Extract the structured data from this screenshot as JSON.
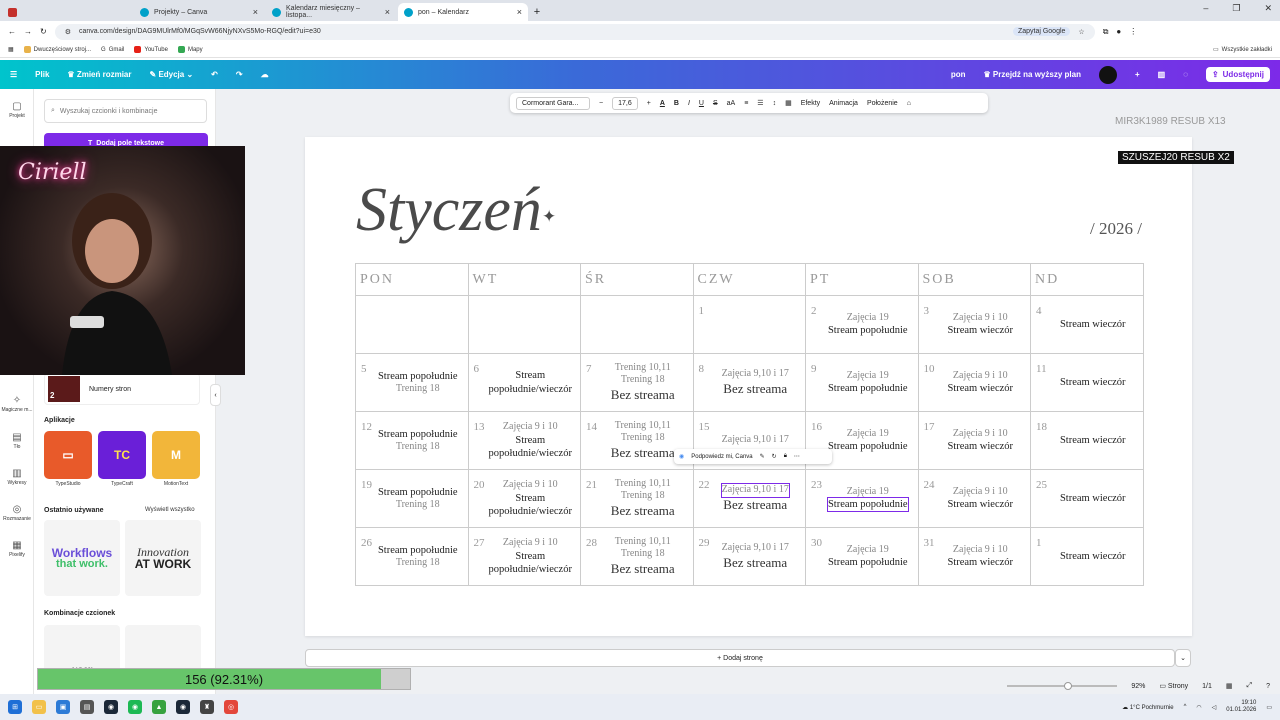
{
  "browser": {
    "tabs": [
      {
        "title": "Projekty – Canva",
        "icon": "canva"
      },
      {
        "title": "Kalendarz miesięczny – listopa...",
        "icon": "canva"
      },
      {
        "title": "pon – Kalendarz",
        "icon": "canva",
        "active": true
      }
    ],
    "url": "canva.com/design/DAG9MUlrMf0/MGqSvW66NjyNXvS5Mo-RGQ/edit?ui=e30",
    "google_button": "Zapytaj Google",
    "bookmarks": [
      "Dwuczęściowy stroj...",
      "Gmail",
      "YouTube",
      "Mapy"
    ],
    "all_bookmarks": "Wszystkie zakładki"
  },
  "canva_toolbar": {
    "file": "Plik",
    "resize": "Zmień rozmiar",
    "edit": "Edycja",
    "design_name": "pon",
    "upgrade": "Przejdź na wyższy plan",
    "share": "Udostępnij"
  },
  "rail": [
    "Projekt",
    "Magiczne m...",
    "Tło",
    "Wykresy",
    "Rozmazanie",
    "Pixelify"
  ],
  "panel": {
    "search_placeholder": "Wyszukaj czcionki i kombinacje",
    "add_text_button": "Dodaj pole tekstowe",
    "page_numbers": "Numery stron",
    "apps_title": "Aplikacje",
    "apps": [
      "TypeStudio",
      "TypeCraft",
      "MotionText"
    ],
    "recent_title": "Ostatnio używane",
    "show_all": "Wyświetl wszystko",
    "recent_items": [
      "Workflows",
      "that work.",
      "Innovation",
      "AT WORK"
    ],
    "combos_title": "Kombinacje czcionek",
    "combo_items": [
      "user"
    ]
  },
  "webcam_overlay": {
    "neon": "Ciriell"
  },
  "text_toolbar": {
    "font": "Cormorant Gara...",
    "size": "17,6",
    "effects": "Efekty",
    "animation": "Animacja",
    "position": "Położenie"
  },
  "stream_overlay": {
    "sub_faded": "MIR3K1989  RESUB X13",
    "sub_highlight": "SZUSZEJ20  RESUB X2"
  },
  "calendar": {
    "month": "Styczeń",
    "star": "✦",
    "year": "/ 2026 /",
    "weekdays": [
      "PON",
      "WT",
      "ŚR",
      "CZW",
      "PT",
      "SOB",
      "ND"
    ],
    "weeks": [
      [
        {
          "day": "",
          "lines": []
        },
        {
          "day": "",
          "lines": []
        },
        {
          "day": "",
          "lines": []
        },
        {
          "day": "1",
          "lines": []
        },
        {
          "day": "2",
          "lines": [
            {
              "t": "Zajęcia 19",
              "s": "g"
            },
            {
              "t": "Stream popołudnie",
              "s": "d"
            }
          ]
        },
        {
          "day": "3",
          "lines": [
            {
              "t": "Zajęcia 9 i 10",
              "s": "g"
            },
            {
              "t": "Stream wieczór",
              "s": "d"
            }
          ]
        },
        {
          "day": "4",
          "lines": [
            {
              "t": "Stream wieczór",
              "s": "d"
            }
          ]
        }
      ],
      [
        {
          "day": "5",
          "lines": [
            {
              "t": "Stream popołudnie",
              "s": "d"
            },
            {
              "t": "Trening 18",
              "s": "g"
            }
          ]
        },
        {
          "day": "6",
          "lines": [
            {
              "t": "Stream popołudnie/wieczór",
              "s": "d"
            }
          ]
        },
        {
          "day": "7",
          "lines": [
            {
              "t": "Trening 10,11",
              "s": "g"
            },
            {
              "t": "Trening 18",
              "s": "g"
            },
            {
              "t": "Bez streama",
              "s": "b"
            }
          ]
        },
        {
          "day": "8",
          "lines": [
            {
              "t": "Zajęcia 9,10 i 17",
              "s": "g"
            },
            {
              "t": "Bez streama",
              "s": "b"
            }
          ]
        },
        {
          "day": "9",
          "lines": [
            {
              "t": "Zajęcia 19",
              "s": "g"
            },
            {
              "t": "Stream popołudnie",
              "s": "d"
            }
          ]
        },
        {
          "day": "10",
          "lines": [
            {
              "t": "Zajęcia 9 i 10",
              "s": "g"
            },
            {
              "t": "Stream wieczór",
              "s": "d"
            }
          ]
        },
        {
          "day": "11",
          "lines": [
            {
              "t": "Stream wieczór",
              "s": "d"
            }
          ]
        }
      ],
      [
        {
          "day": "12",
          "lines": [
            {
              "t": "Stream popołudnie",
              "s": "d"
            },
            {
              "t": "Trening 18",
              "s": "g"
            }
          ]
        },
        {
          "day": "13",
          "lines": [
            {
              "t": "Zajęcia 9 i 10",
              "s": "g"
            },
            {
              "t": "Stream popołudnie/wieczór",
              "s": "d"
            }
          ]
        },
        {
          "day": "14",
          "lines": [
            {
              "t": "Trening 10,11",
              "s": "g"
            },
            {
              "t": "Trening 18",
              "s": "g"
            },
            {
              "t": "Bez streama",
              "s": "b"
            }
          ]
        },
        {
          "day": "15",
          "lines": [
            {
              "t": "Zajęcia 9,10 i 17",
              "s": "g"
            }
          ]
        },
        {
          "day": "16",
          "lines": [
            {
              "t": "Zajęcia 19",
              "s": "g"
            },
            {
              "t": "Stream popołudnie",
              "s": "d"
            }
          ]
        },
        {
          "day": "17",
          "lines": [
            {
              "t": "Zajęcia 9 i 10",
              "s": "g"
            },
            {
              "t": "Stream wieczór",
              "s": "d"
            }
          ]
        },
        {
          "day": "18",
          "lines": [
            {
              "t": "Stream wieczór",
              "s": "d"
            }
          ]
        }
      ],
      [
        {
          "day": "19",
          "lines": [
            {
              "t": "Stream popołudnie",
              "s": "d"
            },
            {
              "t": "Trening 18",
              "s": "g"
            }
          ]
        },
        {
          "day": "20",
          "lines": [
            {
              "t": "Zajęcia 9 i 10",
              "s": "g"
            },
            {
              "t": "Stream popołudnie/wieczór",
              "s": "d"
            }
          ]
        },
        {
          "day": "21",
          "lines": [
            {
              "t": "Trening 10,11",
              "s": "g"
            },
            {
              "t": "Trening 18",
              "s": "g"
            },
            {
              "t": "Bez streama",
              "s": "b"
            }
          ]
        },
        {
          "day": "22",
          "lines": [
            {
              "t": "Zajęcia 9,10 i 17",
              "s": "g",
              "sel": true
            },
            {
              "t": "Bez streama",
              "s": "b"
            }
          ]
        },
        {
          "day": "23",
          "lines": [
            {
              "t": "Zajęcia 19",
              "s": "g"
            },
            {
              "t": "Stream popołudnie",
              "s": "d",
              "sel": true
            }
          ]
        },
        {
          "day": "24",
          "lines": [
            {
              "t": "Zajęcia 9 i 10",
              "s": "g"
            },
            {
              "t": "Stream wieczór",
              "s": "d"
            }
          ]
        },
        {
          "day": "25",
          "lines": [
            {
              "t": "Stream wieczór",
              "s": "d"
            }
          ]
        }
      ],
      [
        {
          "day": "26",
          "lines": [
            {
              "t": "Stream popołudnie",
              "s": "d"
            },
            {
              "t": "Trening 18",
              "s": "g"
            }
          ]
        },
        {
          "day": "27",
          "lines": [
            {
              "t": "Zajęcia 9 i 10",
              "s": "g"
            },
            {
              "t": "Stream popołudnie/wieczór",
              "s": "d"
            }
          ]
        },
        {
          "day": "28",
          "lines": [
            {
              "t": "Trening 10,11",
              "s": "g"
            },
            {
              "t": "Trening 18",
              "s": "g"
            },
            {
              "t": "Bez streama",
              "s": "b"
            }
          ]
        },
        {
          "day": "29",
          "lines": [
            {
              "t": "Zajęcia 9,10 i 17",
              "s": "g"
            },
            {
              "t": "Bez streama",
              "s": "b"
            }
          ]
        },
        {
          "day": "30",
          "lines": [
            {
              "t": "Zajęcia 19",
              "s": "g"
            },
            {
              "t": "Stream popołudnie",
              "s": "d"
            }
          ]
        },
        {
          "day": "31",
          "lines": [
            {
              "t": "Zajęcia 9 i 10",
              "s": "g"
            },
            {
              "t": "Stream wieczór",
              "s": "d"
            }
          ]
        },
        {
          "day": "1",
          "lines": [
            {
              "t": "Stream wieczór",
              "s": "d"
            }
          ]
        }
      ]
    ]
  },
  "ai_popup": {
    "label": "Podpowiedz mi, Canva"
  },
  "add_page": "+ Dodaj stronę",
  "progress": {
    "label": "156 (92.31%)",
    "fraction": 0.9231
  },
  "statusbar": {
    "zoom_level": 0.55,
    "zoom": "92%",
    "pages_label": "Strony",
    "page_count": "1/1"
  },
  "taskbar": {
    "weather_temp": "1°C",
    "weather_desc": "Pochmurnie",
    "time": "19:10",
    "date": "01.01.2026"
  },
  "colors": {
    "accent": "#7d2ae8",
    "teal": "#00c4cc",
    "progress": "#67c56a"
  }
}
